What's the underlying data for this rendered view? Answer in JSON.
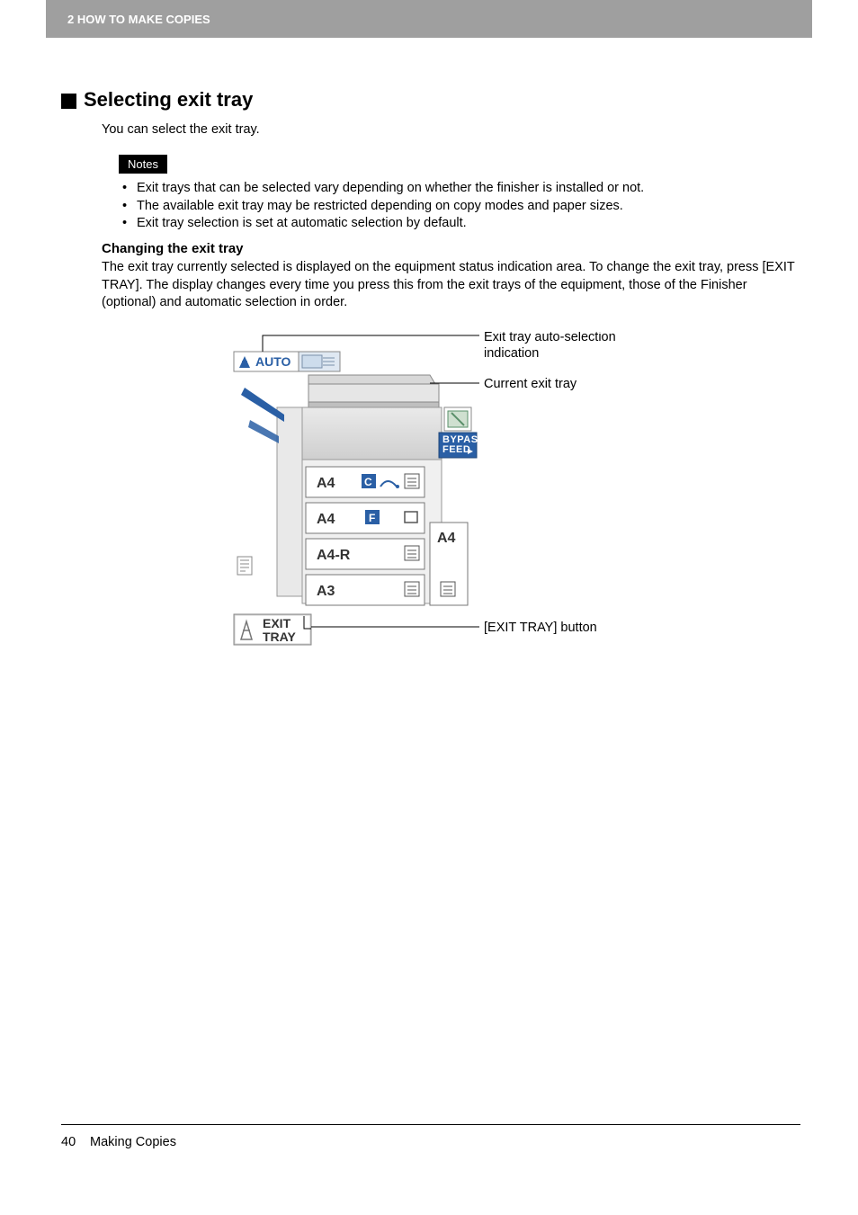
{
  "header": {
    "chapter": "2 HOW TO MAKE COPIES"
  },
  "section": {
    "title": "Selecting exit tray",
    "intro": "You can select the exit tray."
  },
  "notes": {
    "label": "Notes",
    "items": [
      "Exit trays that can be selected vary depending on whether the finisher is installed or not.",
      "The available exit tray may be restricted depending on copy modes and paper sizes.",
      "Exit tray selection is set at automatic selection by default."
    ]
  },
  "subsection": {
    "title": "Changing the exit tray",
    "body": "The exit tray currently selected is displayed on the equipment status indication area. To change the exit tray, press [EXIT TRAY]. The display changes every time you press this from the exit trays of the equipment, those of the Finisher (optional) and automatic selection in order."
  },
  "diagram": {
    "auto_label": "AUTO",
    "bypass_label1": "BYPASS",
    "bypass_label2": "FEED",
    "rows": [
      "A4",
      "A4",
      "A4-R",
      "A3"
    ],
    "side_tray": "A4",
    "exit_label1": "EXIT",
    "exit_label2": "TRAY",
    "callouts": {
      "auto1": "Exit tray auto-selection",
      "auto2": "indication",
      "current": "Current exit tray",
      "button": "[EXIT TRAY] button"
    }
  },
  "footer": {
    "page": "40",
    "title": "Making Copies"
  }
}
